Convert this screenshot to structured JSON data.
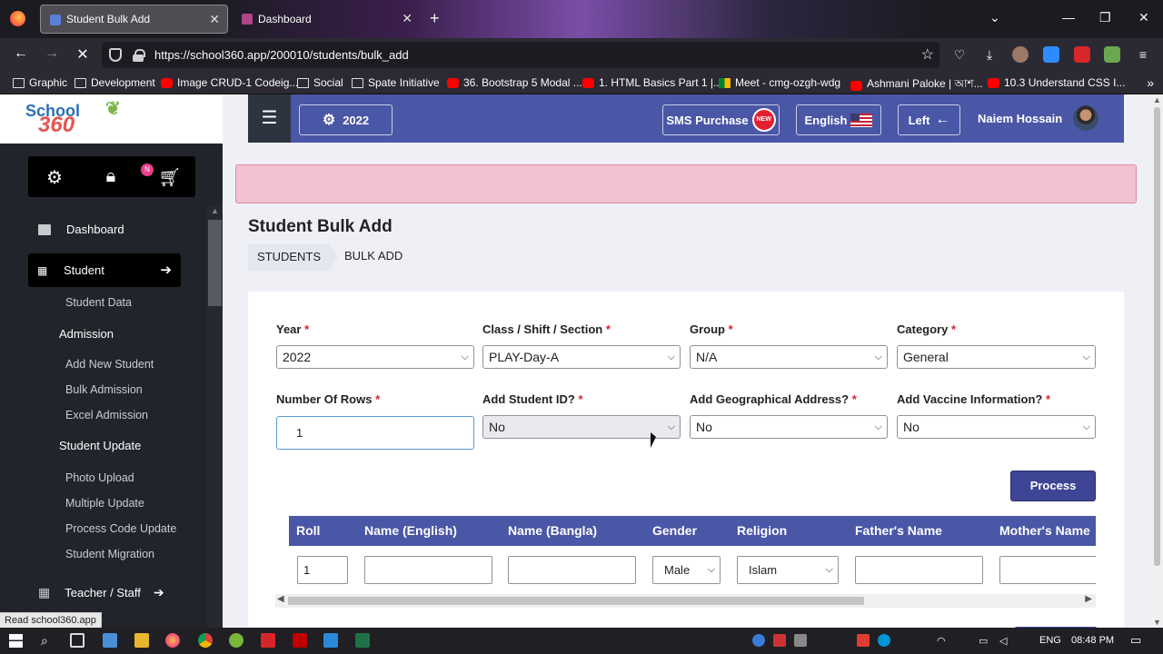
{
  "browser": {
    "tabs": [
      {
        "title": "Student Bulk Add",
        "active": true
      },
      {
        "title": "Dashboard",
        "active": false
      }
    ],
    "url": "https://school360.app/200010/students/bulk_add",
    "bookmarks": [
      "Graphic",
      "Development",
      "Image CRUD-1 Codeig...",
      "Social",
      "Spate Initiative",
      "36. Bootstrap 5 Modal ...",
      "1. HTML Basics Part 1 |...",
      "Meet - cmg-ozgh-wdg",
      "Ashmani Paloke | আশ...",
      "10.3 Understand CSS I..."
    ],
    "status_text": "Read school360.app"
  },
  "logo": {
    "line1": "School",
    "line2": "360"
  },
  "quick": {
    "badge": "N"
  },
  "sidebar": {
    "dashboard": "Dashboard",
    "student": "Student",
    "student_data": "Student Data",
    "admission": "Admission",
    "add_new_student": "Add New Student",
    "bulk_admission": "Bulk Admission",
    "excel_admission": "Excel Admission",
    "student_update": "Student Update",
    "photo_upload": "Photo Upload",
    "multiple_update": "Multiple Update",
    "process_code_update": "Process Code Update",
    "student_migration": "Student Migration",
    "teacher_staff": "Teacher / Staff"
  },
  "header": {
    "year": "2022",
    "sms_purchase": "SMS Purchase",
    "new_badge": "NEW",
    "language": "English",
    "direction": "Left",
    "user_name": "Naiem Hossain"
  },
  "page": {
    "title": "Student Bulk Add",
    "breadcrumb_1": "STUDENTS",
    "breadcrumb_2": "BULK ADD"
  },
  "form": {
    "year": {
      "label": "Year",
      "value": "2022"
    },
    "class": {
      "label": "Class / Shift / Section",
      "value": "PLAY-Day-A"
    },
    "group": {
      "label": "Group",
      "value": "N/A"
    },
    "category": {
      "label": "Category",
      "value": "General"
    },
    "rows": {
      "label": "Number Of Rows",
      "value": "1"
    },
    "student_id": {
      "label": "Add Student ID?",
      "value": "No"
    },
    "geo": {
      "label": "Add Geographical Address?",
      "value": "No"
    },
    "vaccine": {
      "label": "Add Vaccine Information?",
      "value": "No"
    },
    "required_mark": "*",
    "process": "Process"
  },
  "table": {
    "columns": [
      "Roll",
      "Name (English)",
      "Name (Bangla)",
      "Gender",
      "Religion",
      "Father's Name",
      "Mother's Name"
    ],
    "row": {
      "roll": "1",
      "gender": "Male",
      "religion": "Islam"
    }
  },
  "taskbar": {
    "lang": "ENG",
    "time": "08:48 PM"
  },
  "colors": {
    "header": "#4a56a6",
    "sidebar": "#21242b",
    "alert": "#f2c1d2",
    "required": "#d9232d",
    "process_button": "#3d4594"
  }
}
